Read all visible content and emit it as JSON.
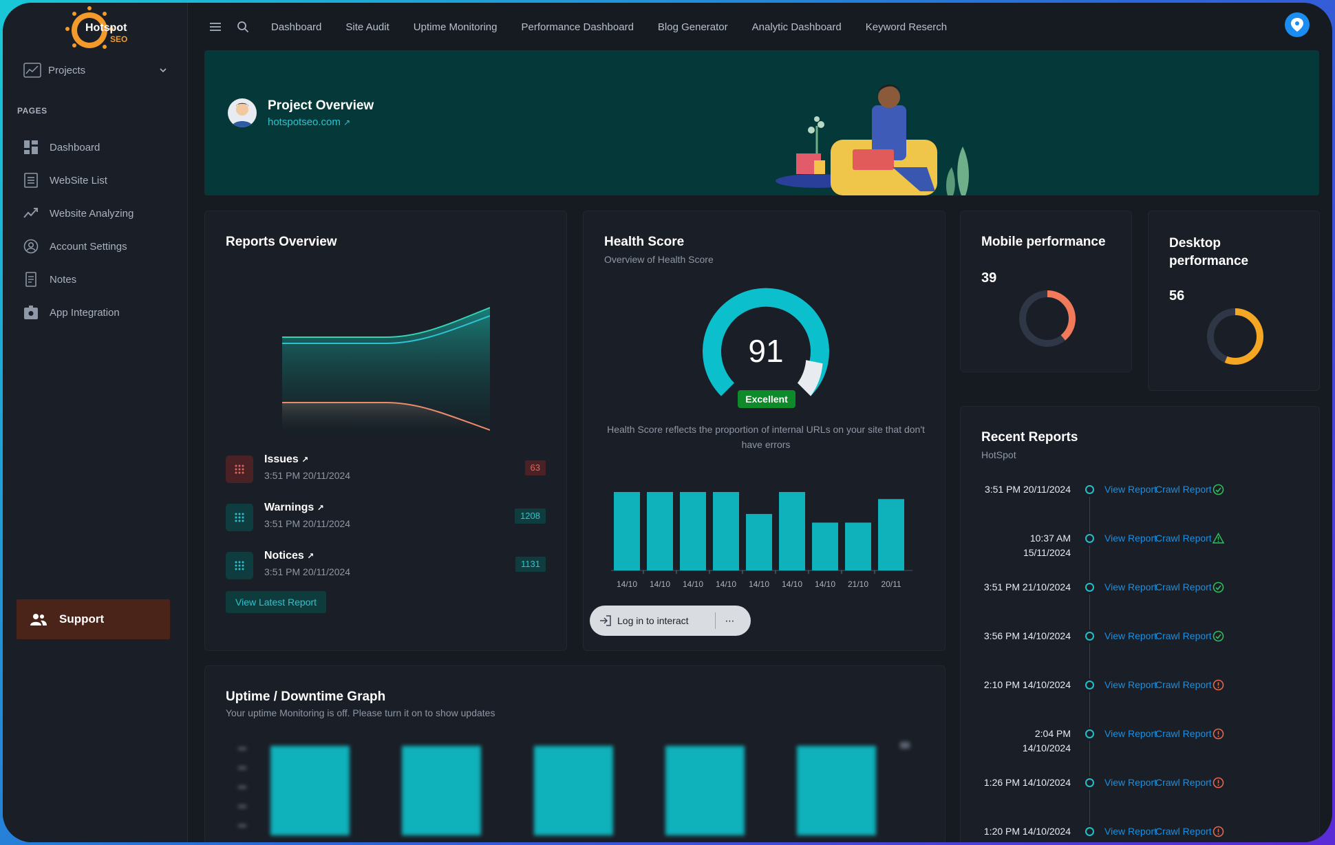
{
  "sidebar": {
    "logo_text": "Hotspot",
    "logo_sub": "SEO",
    "projects_label": "Projects",
    "pages_label": "PAGES",
    "items": [
      {
        "label": "Dashboard",
        "icon": "dashboard-icon"
      },
      {
        "label": "WebSite List",
        "icon": "list-icon"
      },
      {
        "label": "Website Analyzing",
        "icon": "trend-icon"
      },
      {
        "label": "Account Settings",
        "icon": "user-circle-icon"
      },
      {
        "label": "Notes",
        "icon": "notes-icon"
      },
      {
        "label": "App Integration",
        "icon": "integration-icon"
      }
    ],
    "support_label": "Support"
  },
  "topnav": [
    "Dashboard",
    "Site Audit",
    "Uptime Monitoring",
    "Performance Dashboard",
    "Blog Generator",
    "Analytic Dashboard",
    "Keyword Reserch"
  ],
  "banner": {
    "title": "Project Overview",
    "link": "hotspotseo.com"
  },
  "reports_overview": {
    "title": "Reports Overview",
    "items": [
      {
        "name": "Issues",
        "time": "3:51 PM 20/11/2024",
        "count": "63",
        "color": "#e0665a",
        "bg": "#4a2226"
      },
      {
        "name": "Warnings",
        "time": "3:51 PM 20/11/2024",
        "count": "1208",
        "color": "#2cc4d0",
        "bg": "#0f3c3e"
      },
      {
        "name": "Notices",
        "time": "3:51 PM 20/11/2024",
        "count": "1131",
        "color": "#2cc4d0",
        "bg": "#0f3c3e"
      }
    ],
    "view_latest": "View Latest Report"
  },
  "health_score": {
    "title": "Health Score",
    "subtitle": "Overview of Health Score",
    "score": "91",
    "rating": "Excellent",
    "description": "Health Score reflects the proportion of internal URLs on your site that don't have errors",
    "login_label": "Log in to interact",
    "more_label": "⋯"
  },
  "chart_data": {
    "type": "bar",
    "categories": [
      "14/10",
      "14/10",
      "14/10",
      "14/10",
      "14/10",
      "14/10",
      "14/10",
      "21/10",
      "20/11"
    ],
    "values": [
      100,
      100,
      100,
      100,
      72,
      100,
      61,
      61,
      91
    ],
    "ylim": [
      0,
      100
    ],
    "color": "#0fb1bb"
  },
  "mobile_perf": {
    "title": "Mobile performance",
    "value": "39",
    "color": "#f07a5a"
  },
  "desktop_perf": {
    "title": "Desktop performance",
    "value": "56",
    "color": "#f5a623"
  },
  "recent_reports": {
    "title": "Recent Reports",
    "subtitle": "HotSpot",
    "view_label": "View Report",
    "crawl_label": "Crawl Report",
    "rows": [
      {
        "time": "3:51 PM 20/11/2024",
        "status": "success"
      },
      {
        "time": "10:37 AM\n15/11/2024",
        "status": "warning"
      },
      {
        "time": "3:51 PM 21/10/2024",
        "status": "success"
      },
      {
        "time": "3:56 PM 14/10/2024",
        "status": "success"
      },
      {
        "time": "2:10 PM 14/10/2024",
        "status": "error"
      },
      {
        "time": "2:04 PM\n14/10/2024",
        "status": "error"
      },
      {
        "time": "1:26 PM 14/10/2024",
        "status": "error"
      },
      {
        "time": "1:20 PM 14/10/2024",
        "status": "error"
      }
    ]
  },
  "uptime": {
    "title": "Uptime / Downtime Graph",
    "subtitle": "Your uptime Monitoring is off. Please turn it on to show updates"
  }
}
